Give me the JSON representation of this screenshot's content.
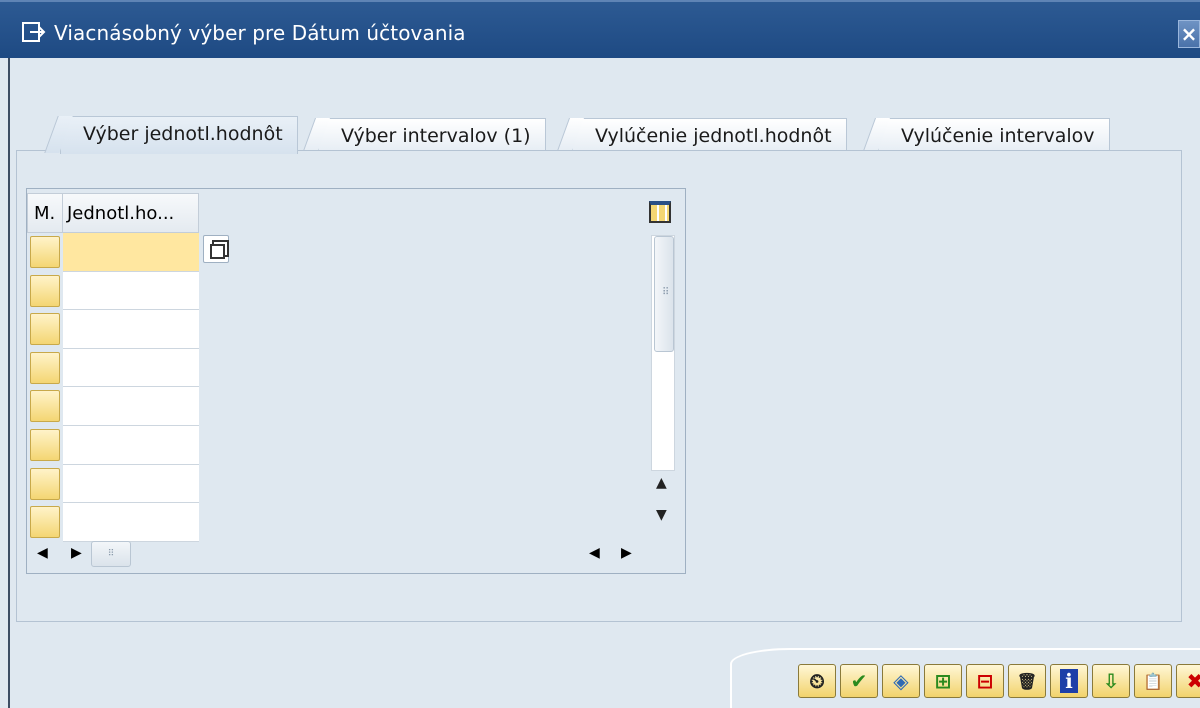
{
  "window": {
    "title": "Viacnásobný výber pre Dátum účtovania",
    "close_label": "×"
  },
  "tabs": [
    {
      "label": "Výber jednotl.hodnôt",
      "active": true
    },
    {
      "label": "Výber intervalov (1)",
      "active": false
    },
    {
      "label": "Vylúčenie jednotl.hodnôt",
      "active": false
    },
    {
      "label": "Vylúčenie intervalov",
      "active": false
    }
  ],
  "grid": {
    "columns": [
      "M.",
      "Jednotl.ho..."
    ],
    "rows": [
      "",
      "",
      "",
      "",
      "",
      "",
      "",
      ""
    ],
    "selected_row": 0
  },
  "toolbar": [
    {
      "icon": "execute-icon",
      "glyph": "⏲"
    },
    {
      "icon": "check-icon",
      "glyph": "✔"
    },
    {
      "icon": "multiple-selection-icon",
      "glyph": "◈"
    },
    {
      "icon": "insert-row-icon",
      "glyph": "⊞"
    },
    {
      "icon": "delete-row-icon",
      "glyph": "⊟"
    },
    {
      "icon": "trash-icon",
      "glyph": "🗑"
    },
    {
      "icon": "info-icon",
      "glyph": "ℹ"
    },
    {
      "icon": "import-icon",
      "glyph": "⇩"
    },
    {
      "icon": "clipboard-icon",
      "glyph": "📋"
    },
    {
      "icon": "cancel-icon",
      "glyph": "✖"
    }
  ],
  "colors": {
    "titlebar": "#1e4a83",
    "cell_selected": "#ffe7a0",
    "cancel": "#cc0000",
    "check": "#2b8a1e"
  }
}
